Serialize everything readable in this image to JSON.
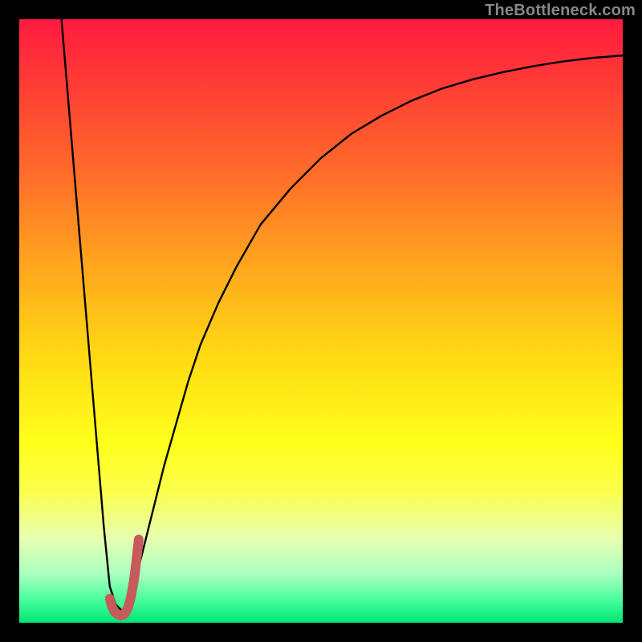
{
  "watermark": "TheBottleneck.com",
  "gradient_stops": [
    {
      "offset": 0.0,
      "color": "#ff1a3f"
    },
    {
      "offset": 0.1,
      "color": "#ff3a36"
    },
    {
      "offset": 0.25,
      "color": "#ff6a2a"
    },
    {
      "offset": 0.4,
      "color": "#ffa31e"
    },
    {
      "offset": 0.55,
      "color": "#ffd714"
    },
    {
      "offset": 0.7,
      "color": "#ffff1a"
    },
    {
      "offset": 0.78,
      "color": "#fbff4a"
    },
    {
      "offset": 0.86,
      "color": "#e7ffb0"
    },
    {
      "offset": 0.92,
      "color": "#a8ffc0"
    },
    {
      "offset": 0.96,
      "color": "#4dff9d"
    },
    {
      "offset": 1.0,
      "color": "#00e676"
    }
  ],
  "chart_data": {
    "type": "line",
    "title": "",
    "xlabel": "",
    "ylabel": "",
    "xlim": [
      0,
      100
    ],
    "ylim": [
      0,
      100
    ],
    "series": [
      {
        "name": "main-curve",
        "color": "#000000",
        "width": 2.4,
        "x": [
          7,
          8,
          9,
          10,
          11,
          12,
          13,
          14,
          15,
          16,
          17,
          18,
          19,
          20,
          22,
          24,
          26,
          28,
          30,
          33,
          36,
          40,
          45,
          50,
          55,
          60,
          65,
          70,
          75,
          80,
          85,
          90,
          95,
          100
        ],
        "y": [
          100,
          88,
          76,
          64,
          52,
          40,
          28,
          16,
          6,
          3,
          2,
          3,
          6,
          10,
          18,
          26,
          33,
          40,
          46,
          53,
          59,
          66,
          72,
          77,
          81,
          84,
          86.5,
          88.5,
          90,
          91.2,
          92.2,
          93,
          93.6,
          94
        ]
      },
      {
        "name": "highlight-hook",
        "color": "#c75a5a",
        "width": 12,
        "linecap": "round",
        "x": [
          15.0,
          15.4,
          15.8,
          16.3,
          16.8,
          17.4,
          18.0,
          18.5,
          19.0,
          19.4,
          19.8
        ],
        "y": [
          4.0,
          2.6,
          1.8,
          1.4,
          1.2,
          1.4,
          2.4,
          4.2,
          7.0,
          10.2,
          13.8
        ]
      }
    ]
  }
}
